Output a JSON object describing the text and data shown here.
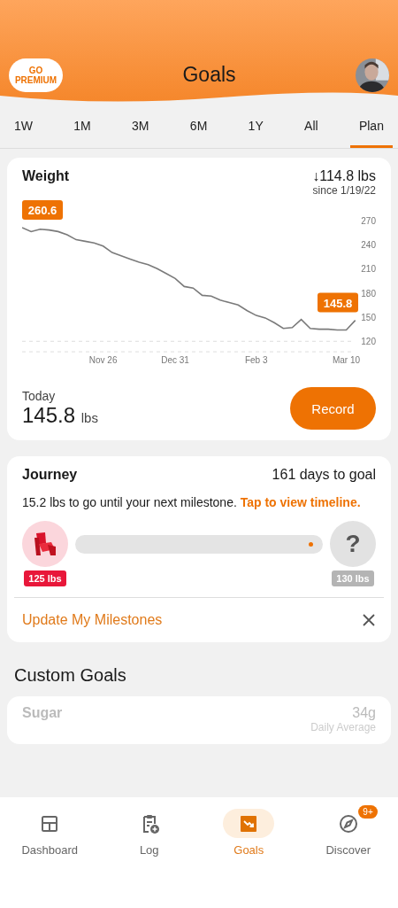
{
  "header": {
    "premium_button": "GO PREMIUM",
    "title": "Goals"
  },
  "tabs": [
    {
      "label": "1W",
      "selected": false
    },
    {
      "label": "1M",
      "selected": false
    },
    {
      "label": "3M",
      "selected": false
    },
    {
      "label": "6M",
      "selected": false
    },
    {
      "label": "1Y",
      "selected": false
    },
    {
      "label": "All",
      "selected": false
    },
    {
      "label": "Plan",
      "selected": true
    }
  ],
  "weight_card": {
    "title": "Weight",
    "change_arrow": "↓",
    "change": "114.8 lbs",
    "since": "since 1/19/22",
    "chart_data": {
      "type": "line",
      "categories": [
        null,
        null,
        null,
        null,
        null,
        null,
        null,
        null,
        null,
        "Nov 26",
        null,
        null,
        null,
        null,
        null,
        null,
        null,
        "Dec 31",
        null,
        null,
        null,
        null,
        null,
        null,
        null,
        null,
        "Feb 3",
        null,
        null,
        null,
        null,
        null,
        null,
        null,
        null,
        null,
        "Mar 10",
        null
      ],
      "series": [
        {
          "color": "#7a7a7a",
          "values": [
            261,
            256,
            259,
            258,
            256,
            252,
            246,
            244,
            242,
            238,
            230,
            226,
            222,
            218,
            215,
            210,
            204,
            198,
            188,
            186,
            177,
            176,
            171,
            168,
            165,
            158,
            152,
            149,
            143,
            136,
            137,
            147,
            136,
            135,
            135,
            134,
            134,
            146
          ]
        }
      ],
      "ylim": [
        107,
        270
      ],
      "yticks": [
        120,
        150,
        180,
        210,
        240,
        270
      ],
      "annotations": [
        "260.6",
        "145.8"
      ]
    },
    "today_label": "Today",
    "today_value": "145.8",
    "today_unit": "lbs",
    "record_button": "Record"
  },
  "journey_card": {
    "title": "Journey",
    "days": "161 days to goal",
    "message": "15.2 lbs to go until your next milestone.",
    "link": "Tap to view timeline.",
    "progress": {
      "level": 0.96
    },
    "milestones": [
      {
        "kind": "reached",
        "label": "125 lbs"
      },
      {
        "kind": "unknown",
        "symbol": "?",
        "label": "130 lbs"
      }
    ],
    "update_link": "Update My Milestones"
  },
  "custom_goals": {
    "title": "Custom Goals",
    "goals": [
      {
        "name": "Sugar",
        "value": "34g",
        "caption": "Daily Average"
      }
    ]
  },
  "bottom_nav": [
    {
      "kind": "dashboard",
      "label": "Dashboard",
      "selected": false
    },
    {
      "kind": "log",
      "label": "Log",
      "selected": false
    },
    {
      "kind": "goals",
      "label": "Goals",
      "selected": true
    },
    {
      "kind": "discover",
      "label": "Discover",
      "selected": false,
      "badge": "9+"
    }
  ]
}
